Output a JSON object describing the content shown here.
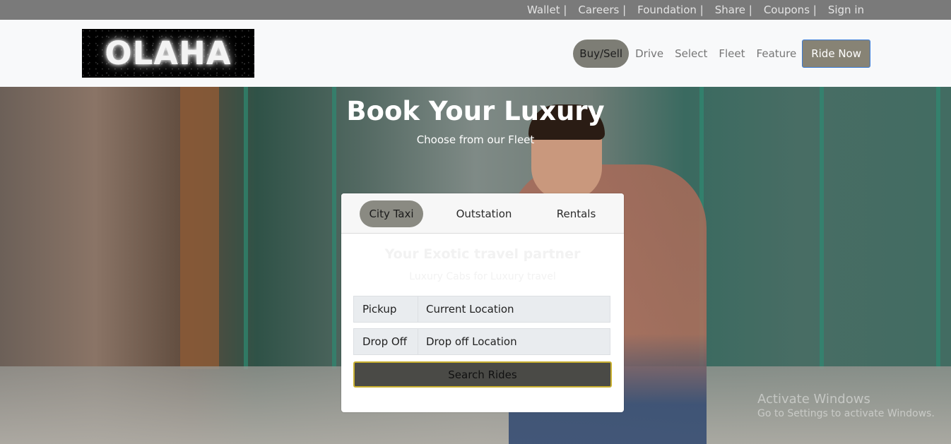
{
  "topbar": {
    "links": [
      "Wallet |",
      "Careers |",
      "Foundation |",
      "Share |",
      "Coupons |",
      "Sign in"
    ]
  },
  "header": {
    "logo_text": "OLAHA",
    "nav_active": "Buy/Sell",
    "nav_links": [
      "Drive",
      "Select",
      "Fleet",
      "Feature"
    ],
    "cta_label": "Ride Now"
  },
  "hero": {
    "title": "Book Your Luxury",
    "subtitle": "Choose from our Fleet"
  },
  "booking": {
    "tabs": [
      {
        "label": "City Taxi",
        "active": true
      },
      {
        "label": "Outstation",
        "active": false
      },
      {
        "label": "Rentals",
        "active": false
      }
    ],
    "heading": "Your Exotic travel partner",
    "subheading": "Luxury Cabs for Luxury travel",
    "pickup": {
      "label": "Pickup",
      "value": "Current Location"
    },
    "dropoff": {
      "label": "Drop Off",
      "value": "Drop off Location"
    },
    "search_label": "Search Rides"
  },
  "os_watermark": {
    "line1": "Activate Windows",
    "line2": "Go to Settings to activate Windows."
  },
  "colors": {
    "topbar_bg": "#7a7a7a",
    "nav_pill": "#7d7d75",
    "cta_border": "#3b7dd8",
    "search_border": "#c9b030"
  }
}
